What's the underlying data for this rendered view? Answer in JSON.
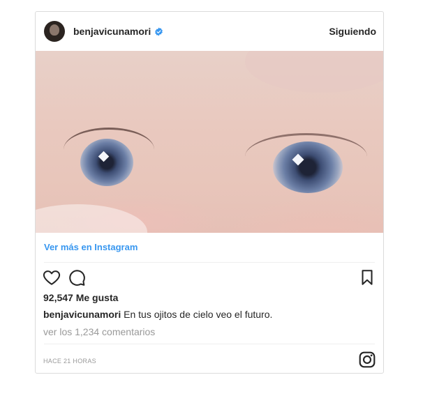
{
  "header": {
    "username": "benjavicunamori",
    "follow_label": "Siguiendo"
  },
  "post": {
    "view_link": "Ver más en Instagram",
    "likes": "92,547 Me gusta",
    "caption_user": "benjavicunamori",
    "caption_text": "En tus ojitos de cielo veo el futuro.",
    "comments_link": "ver los 1,234 comentarios",
    "timestamp": "HACE 21 HORAS"
  },
  "icons": [
    "avatar",
    "verified-badge-icon",
    "heart-icon",
    "comment-icon",
    "bookmark-icon",
    "instagram-logo-icon"
  ],
  "colors": {
    "link": "#3897f0",
    "verified": "#3897f0",
    "text": "#262626",
    "muted": "#999999"
  }
}
